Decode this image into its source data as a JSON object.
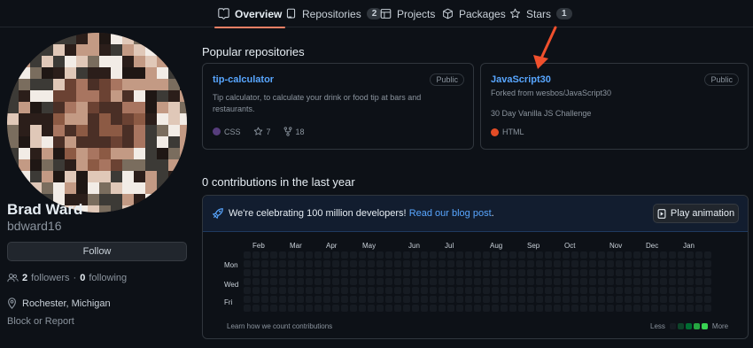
{
  "tabs": [
    {
      "label": "Overview",
      "count": null,
      "active": true,
      "icon": "book-icon"
    },
    {
      "label": "Repositories",
      "count": "2",
      "active": false,
      "icon": "repo-icon"
    },
    {
      "label": "Projects",
      "count": null,
      "active": false,
      "icon": "table-icon"
    },
    {
      "label": "Packages",
      "count": null,
      "active": false,
      "icon": "package-icon"
    },
    {
      "label": "Stars",
      "count": "1",
      "active": false,
      "icon": "star-icon"
    }
  ],
  "profile": {
    "name": "Brad Ward",
    "login": "bdward16",
    "follow_label": "Follow",
    "followers_count": "2",
    "followers_label": "followers",
    "separator": "·",
    "following_count": "0",
    "following_label": "following",
    "location": "Rochester, Michigan",
    "block_label": "Block or Report"
  },
  "popular": {
    "title": "Popular repositories",
    "repos": [
      {
        "name": "tip-calculator",
        "visibility": "Public",
        "forked_from": "",
        "description": "Tip calculator, to calculate your drink or food tip at bars and restaurants.",
        "language": "CSS",
        "language_color": "#563d7c",
        "stars": "7",
        "forks": "18"
      },
      {
        "name": "JavaScript30",
        "visibility": "Public",
        "forked_from": "Forked from wesbos/JavaScript30",
        "description": "30 Day Vanilla JS Challenge",
        "language": "HTML",
        "language_color": "#e34c26",
        "stars": "",
        "forks": ""
      }
    ]
  },
  "contributions": {
    "title": "0 contributions in the last year",
    "banner_text": "We're celebrating 100 million developers!",
    "banner_link": "Read our blog post",
    "banner_end": ".",
    "play_label": "Play animation",
    "months": [
      "Feb",
      "Mar",
      "Apr",
      "May",
      "Jun",
      "Jul",
      "Aug",
      "Sep",
      "Oct",
      "Nov",
      "Dec",
      "Jan"
    ],
    "days": [
      "Mon",
      "Wed",
      "Fri"
    ],
    "footer_link": "Learn how we count contributions",
    "legend_less": "Less",
    "legend_more": "More",
    "legend_colors": [
      "#161b22",
      "#0e4429",
      "#006d32",
      "#26a641",
      "#39d353"
    ],
    "empty_color": "#161b22"
  },
  "colors": {
    "accent": "#58a6ff",
    "tab_underline": "#f78166",
    "annotation_arrow": "#f0502d"
  }
}
